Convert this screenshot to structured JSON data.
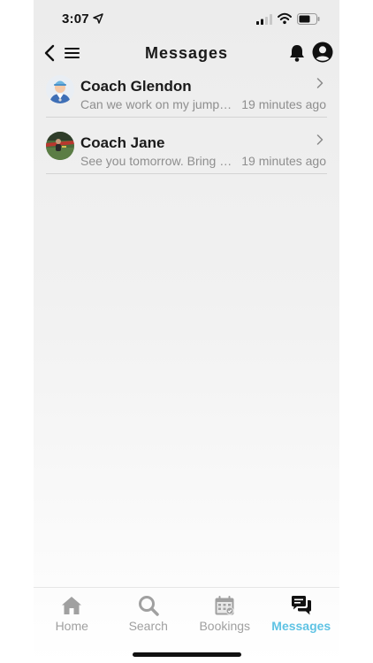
{
  "status_bar": {
    "time": "3:07"
  },
  "nav": {
    "title": "Messages"
  },
  "messages": [
    {
      "name": "Coach Glendon",
      "preview": "Can we work on my jumpshot?",
      "time": "19 minutes ago",
      "avatar": "coach-cartoon-avatar"
    },
    {
      "name": "Coach Jane",
      "preview": "See you tomorrow. Bring your gear.",
      "time": "19 minutes ago",
      "avatar": "athlete-photo-avatar"
    }
  ],
  "tabs": [
    {
      "label": "Home",
      "icon": "home-icon",
      "active": false
    },
    {
      "label": "Search",
      "icon": "search-icon",
      "active": false
    },
    {
      "label": "Bookings",
      "icon": "calendar-icon",
      "active": false
    },
    {
      "label": "Messages",
      "icon": "chat-icon",
      "active": true
    }
  ],
  "colors": {
    "accent": "#5fc3e4",
    "inactive": "#a0a0a0",
    "text": "#1a1a1a"
  }
}
